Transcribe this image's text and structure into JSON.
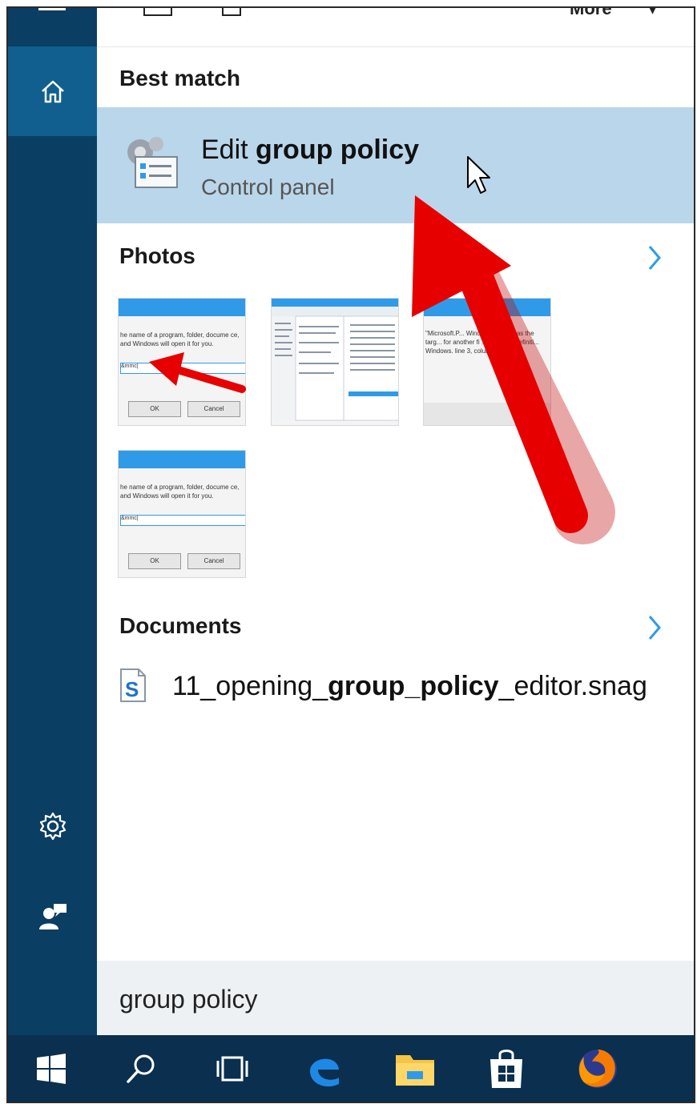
{
  "top_strip": {
    "more_label": "More",
    "caret": "▾"
  },
  "sections": {
    "best_match": "Best match",
    "photos": "Photos",
    "documents": "Documents"
  },
  "best_match": {
    "title_prefix": "Edit ",
    "title_bold": "group policy",
    "subtitle": "Control panel"
  },
  "photos": [
    {
      "text": "he name of a program, folder, docume ce, and Windows will open it for you.",
      "field": "&mmc|",
      "ok": "OK",
      "cancel": "Cancel"
    },
    {
      "text": "",
      "field": "",
      "ok": "",
      "cancel": ""
    },
    {
      "text": "\"Microsoft.P... WindowsLoca ed as the targ... for another fi ... VSPolicyDefiniti... Windows. line 3, column 110",
      "field": "",
      "ok": "",
      "cancel": ""
    },
    {
      "text": "he name of a program, folder, docume ce, and Windows will open it for you.",
      "field": "&mmc|",
      "ok": "OK",
      "cancel": "Cancel"
    }
  ],
  "document": {
    "prefix": "11_opening_",
    "bold": "group_policy",
    "suffix": "_editor.snag"
  },
  "search": {
    "query": "group policy"
  },
  "taskbar": {
    "items": [
      "windows-start-icon",
      "search-icon",
      "task-view-icon",
      "edge-icon",
      "file-explorer-icon",
      "store-icon",
      "firefox-icon"
    ]
  },
  "colors": {
    "rail": "#0b3e63",
    "rail_active": "#115f8e",
    "highlight": "#bad6ea",
    "taskbar": "#0a2f4f",
    "accent": "#2f9be8",
    "arrow": "#e60000"
  }
}
